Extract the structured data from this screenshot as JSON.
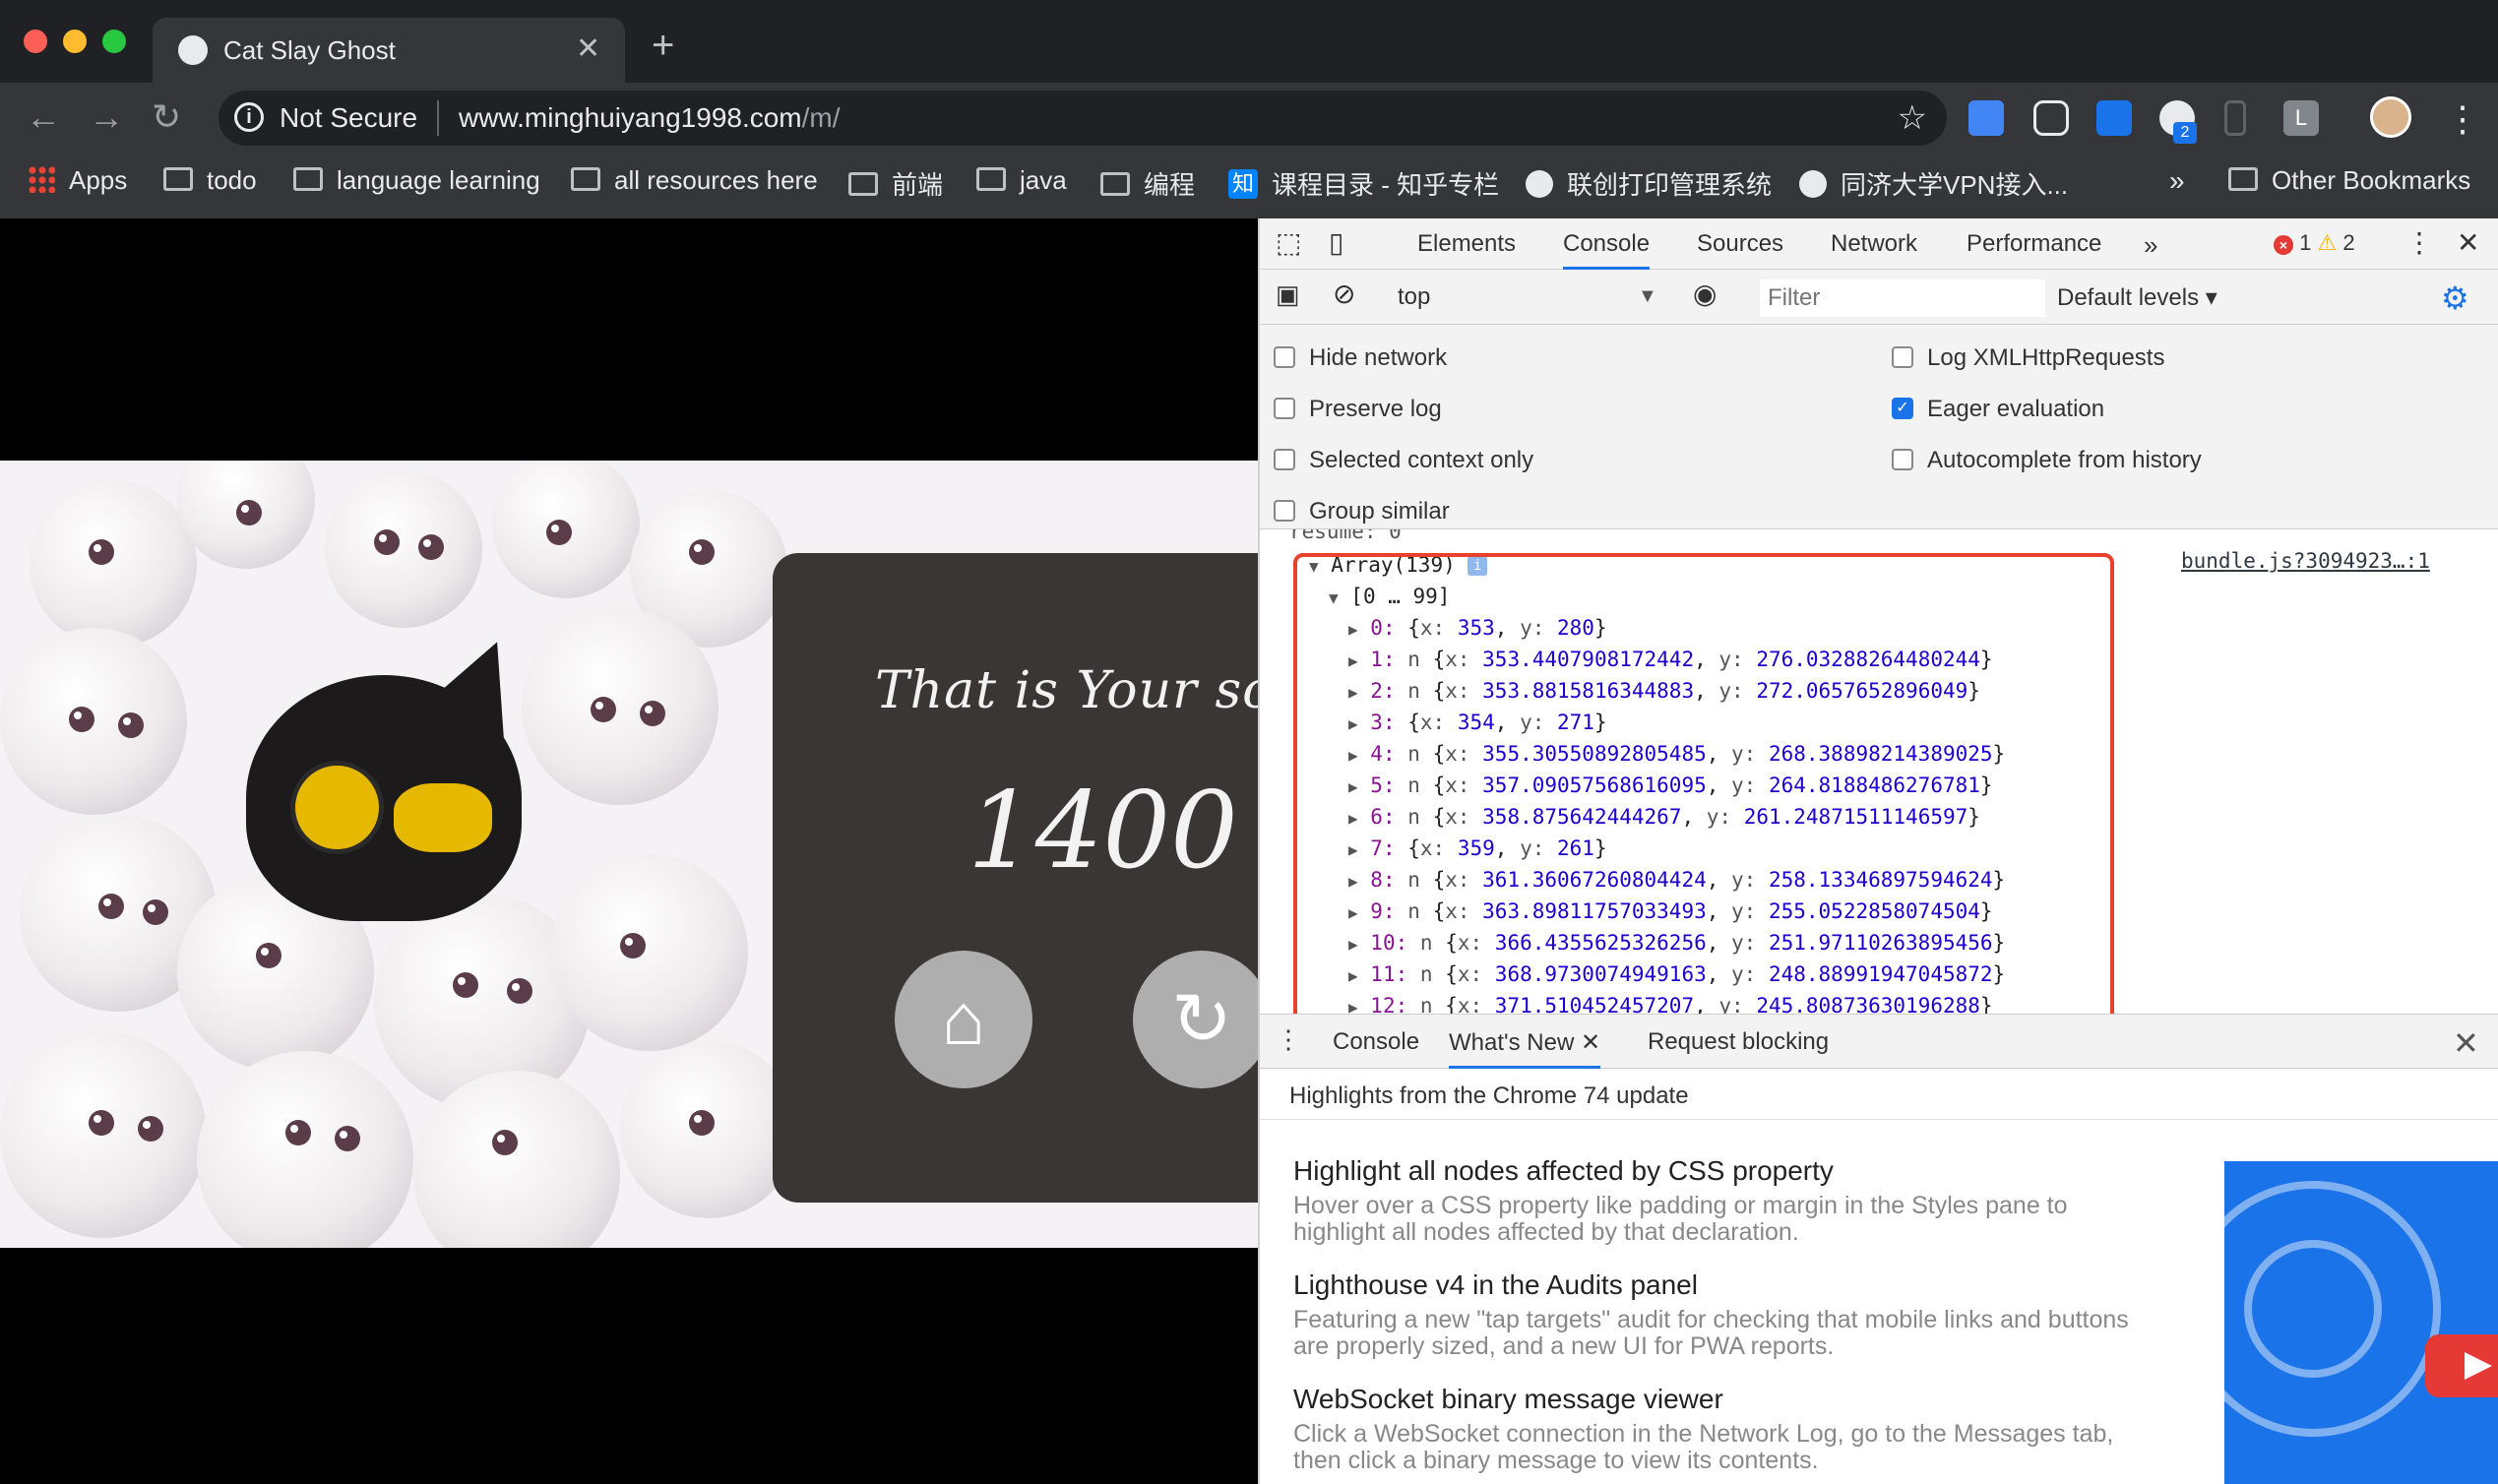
{
  "browser": {
    "tab_title": "Cat Slay Ghost",
    "tab_close": "✕",
    "new_tab": "+",
    "security_label": "Not Secure",
    "url_host": "www.minghuiyang1998.com",
    "url_path": "/m/",
    "ext_badge": "2",
    "ext_letter": "L"
  },
  "bookmarks": {
    "items": [
      {
        "label": "Apps",
        "icon": "apps-grid-icon"
      },
      {
        "label": "todo",
        "icon": "folder-icon"
      },
      {
        "label": "language learning",
        "icon": "folder-icon"
      },
      {
        "label": "all resources here",
        "icon": "folder-icon"
      },
      {
        "label": "前端",
        "icon": "folder-icon"
      },
      {
        "label": "java",
        "icon": "folder-icon"
      },
      {
        "label": "编程",
        "icon": "folder-icon"
      },
      {
        "label": "课程目录 - 知乎专栏",
        "icon": "zhihu-icon"
      },
      {
        "label": "联创打印管理系统",
        "icon": "globe-icon"
      },
      {
        "label": "同济大学VPN接入...",
        "icon": "globe-icon"
      }
    ],
    "overflow": "»",
    "other": "Other Bookmarks"
  },
  "game": {
    "caption": "That is Your scor",
    "score": "1400",
    "home_icon": "home-icon",
    "replay_icon": "replay-icon"
  },
  "devtools": {
    "tabs": [
      "Elements",
      "Console",
      "Sources",
      "Network",
      "Performance"
    ],
    "active_tab": "Console",
    "more_tabs": "»",
    "error_count": "1",
    "warning_count": "2",
    "context": "top",
    "filter_placeholder": "Filter",
    "levels": "Default levels ▾",
    "settings": {
      "left": [
        {
          "label": "Hide network",
          "checked": false
        },
        {
          "label": "Preserve log",
          "checked": false
        },
        {
          "label": "Selected context only",
          "checked": false
        },
        {
          "label": "Group similar",
          "checked": false
        }
      ],
      "right": [
        {
          "label": "Log XMLHttpRequests",
          "checked": false
        },
        {
          "label": "Eager evaluation",
          "checked": true
        },
        {
          "label": "Autocomplete from history",
          "checked": false
        }
      ]
    },
    "log": {
      "partial_line": "resume: 0",
      "source": "bundle.js?3094923…:1",
      "array_header": "Array(139)",
      "range": "[0 … 99]",
      "entries": [
        {
          "index": "0:",
          "cls": "",
          "x": "353",
          "y": "280"
        },
        {
          "index": "1:",
          "cls": "n",
          "x": "353.4407908172442",
          "y": "276.03288264480244"
        },
        {
          "index": "2:",
          "cls": "n",
          "x": "353.8815816344883",
          "y": "272.0657652896049"
        },
        {
          "index": "3:",
          "cls": "",
          "x": "354",
          "y": "271"
        },
        {
          "index": "4:",
          "cls": "n",
          "x": "355.30550892805485",
          "y": "268.38898214389025"
        },
        {
          "index": "5:",
          "cls": "n",
          "x": "357.09057568616095",
          "y": "264.8188486276781"
        },
        {
          "index": "6:",
          "cls": "n",
          "x": "358.875642444267",
          "y": "261.24871511146597"
        },
        {
          "index": "7:",
          "cls": "",
          "x": "359",
          "y": "261"
        },
        {
          "index": "8:",
          "cls": "n",
          "x": "361.36067260804424",
          "y": "258.13346897594624"
        },
        {
          "index": "9:",
          "cls": "n",
          "x": "363.89811757033493",
          "y": "255.0522858074504"
        },
        {
          "index": "10:",
          "cls": "n",
          "x": "366.4355625326256",
          "y": "251.97110263895456"
        },
        {
          "index": "11:",
          "cls": "n",
          "x": "368.9730074949163",
          "y": "248.88991947045872"
        },
        {
          "index": "12:",
          "cls": "n",
          "x": "371.510452457207",
          "y": "245.80873630196288"
        }
      ]
    },
    "drawer": {
      "tabs": [
        "Console",
        "What's New",
        "Request blocking"
      ],
      "active_tab": "What's New",
      "close": "✕"
    },
    "whats_new": {
      "heading": "Highlights from the Chrome 74 update",
      "items": [
        {
          "title": "Highlight all nodes affected by CSS property",
          "desc": "Hover over a CSS property like padding or margin in the Styles pane to highlight all nodes affected by that declaration."
        },
        {
          "title": "Lighthouse v4 in the Audits panel",
          "desc": "Featuring a new \"tap targets\" audit for checking that mobile links and buttons are properly sized, and a new UI for PWA reports."
        },
        {
          "title": "WebSocket binary message viewer",
          "desc": "Click a WebSocket connection in the Network Log, go to the Messages tab, then click a binary message to view its contents."
        }
      ]
    }
  },
  "colors": {
    "accent": "#1a73e8",
    "highlight_box": "#e8412c",
    "error": "#e53935",
    "warning": "#f5b400"
  }
}
